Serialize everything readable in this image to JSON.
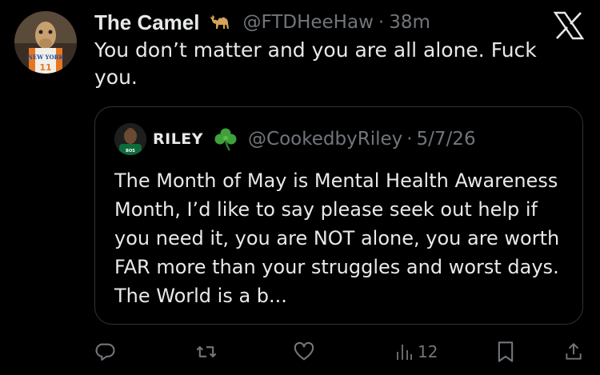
{
  "tweet": {
    "display_name": "The Camel",
    "name_emoji": "camel-emoji",
    "handle": "@FTDHeeHaw",
    "separator": "·",
    "time": "38m",
    "text": "You don’t matter and you are all alone. Fuck you.",
    "avatar_jersey_text": "NEW YORK",
    "avatar_jersey_number": "11"
  },
  "quote": {
    "display_name": "RILEY",
    "name_emoji": "shamrock-emoji",
    "handle": "@CookedbyRiley",
    "separator": "·",
    "date": "5/7/26",
    "text": "The Month of May is Mental Health Awareness Month, I’d like to say please seek out help if you need it, you are NOT alone, you are worth FAR more than your struggles and worst days. The World is a b..."
  },
  "actions": {
    "views": "12"
  },
  "colors": {
    "background": "#000000",
    "text_primary": "#e7e9ea",
    "text_secondary": "#71767b",
    "border": "#2f3336"
  }
}
